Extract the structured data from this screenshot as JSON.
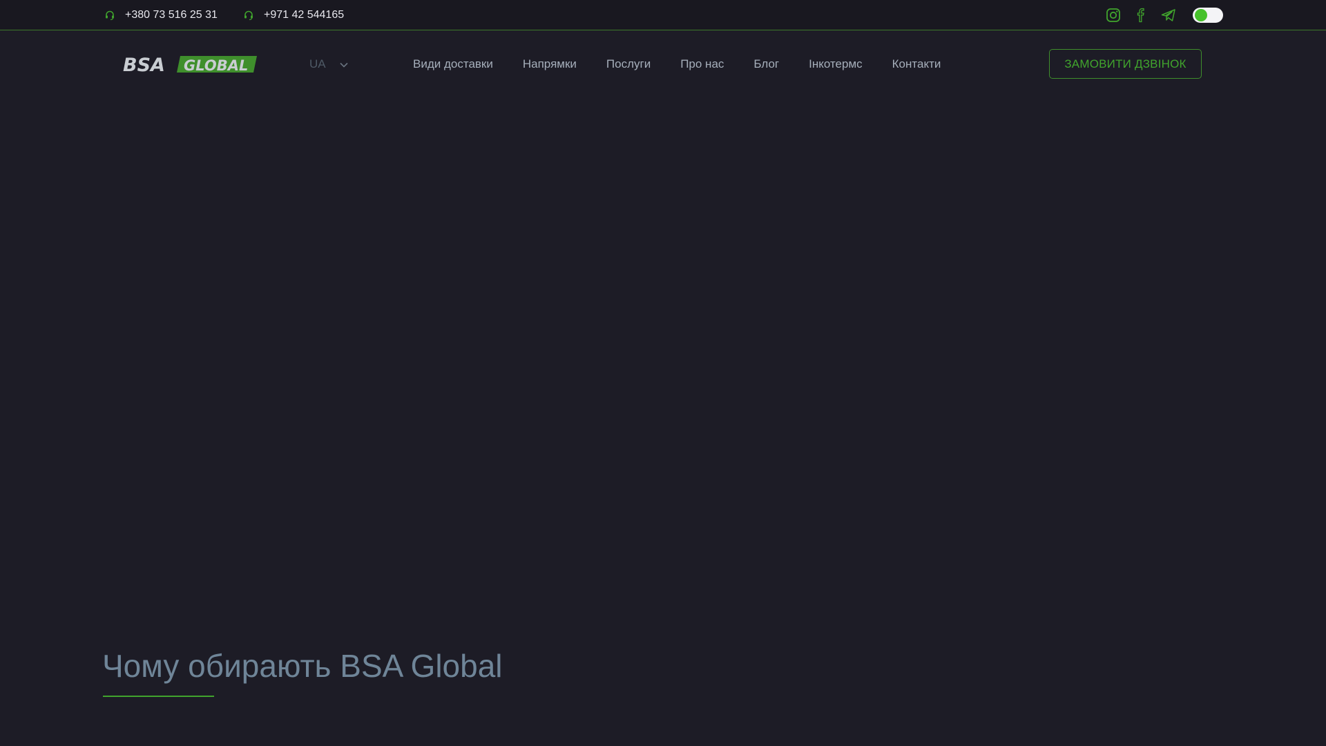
{
  "topbar": {
    "phones": [
      {
        "number": "+380 73 516 25 31",
        "icon": "headset-icon"
      },
      {
        "number": "+971 42 544165",
        "icon": "headset-icon"
      }
    ],
    "socials": [
      "instagram-icon",
      "facebook-icon",
      "telegram-icon"
    ],
    "theme_toggle": {
      "state": "on"
    }
  },
  "header": {
    "logo": {
      "word1": "BSA",
      "word2": "GLOBAL"
    },
    "language": {
      "selected": "UA",
      "icon": "chevron-down-icon"
    },
    "nav": [
      "Види доставки",
      "Напрямки",
      "Послуги",
      "Про нас",
      "Блог",
      "Інкотермс",
      "Контакти"
    ],
    "cta_label": "ЗАМОВИТИ ДЗВІНОК"
  },
  "section": {
    "title": "Чому обирають BSA Global"
  },
  "colors": {
    "background": "#1d1c26",
    "topbar": "#191820",
    "accent": "#41a52d",
    "nav_text": "#a6afbb",
    "title_text": "#6f8598"
  }
}
